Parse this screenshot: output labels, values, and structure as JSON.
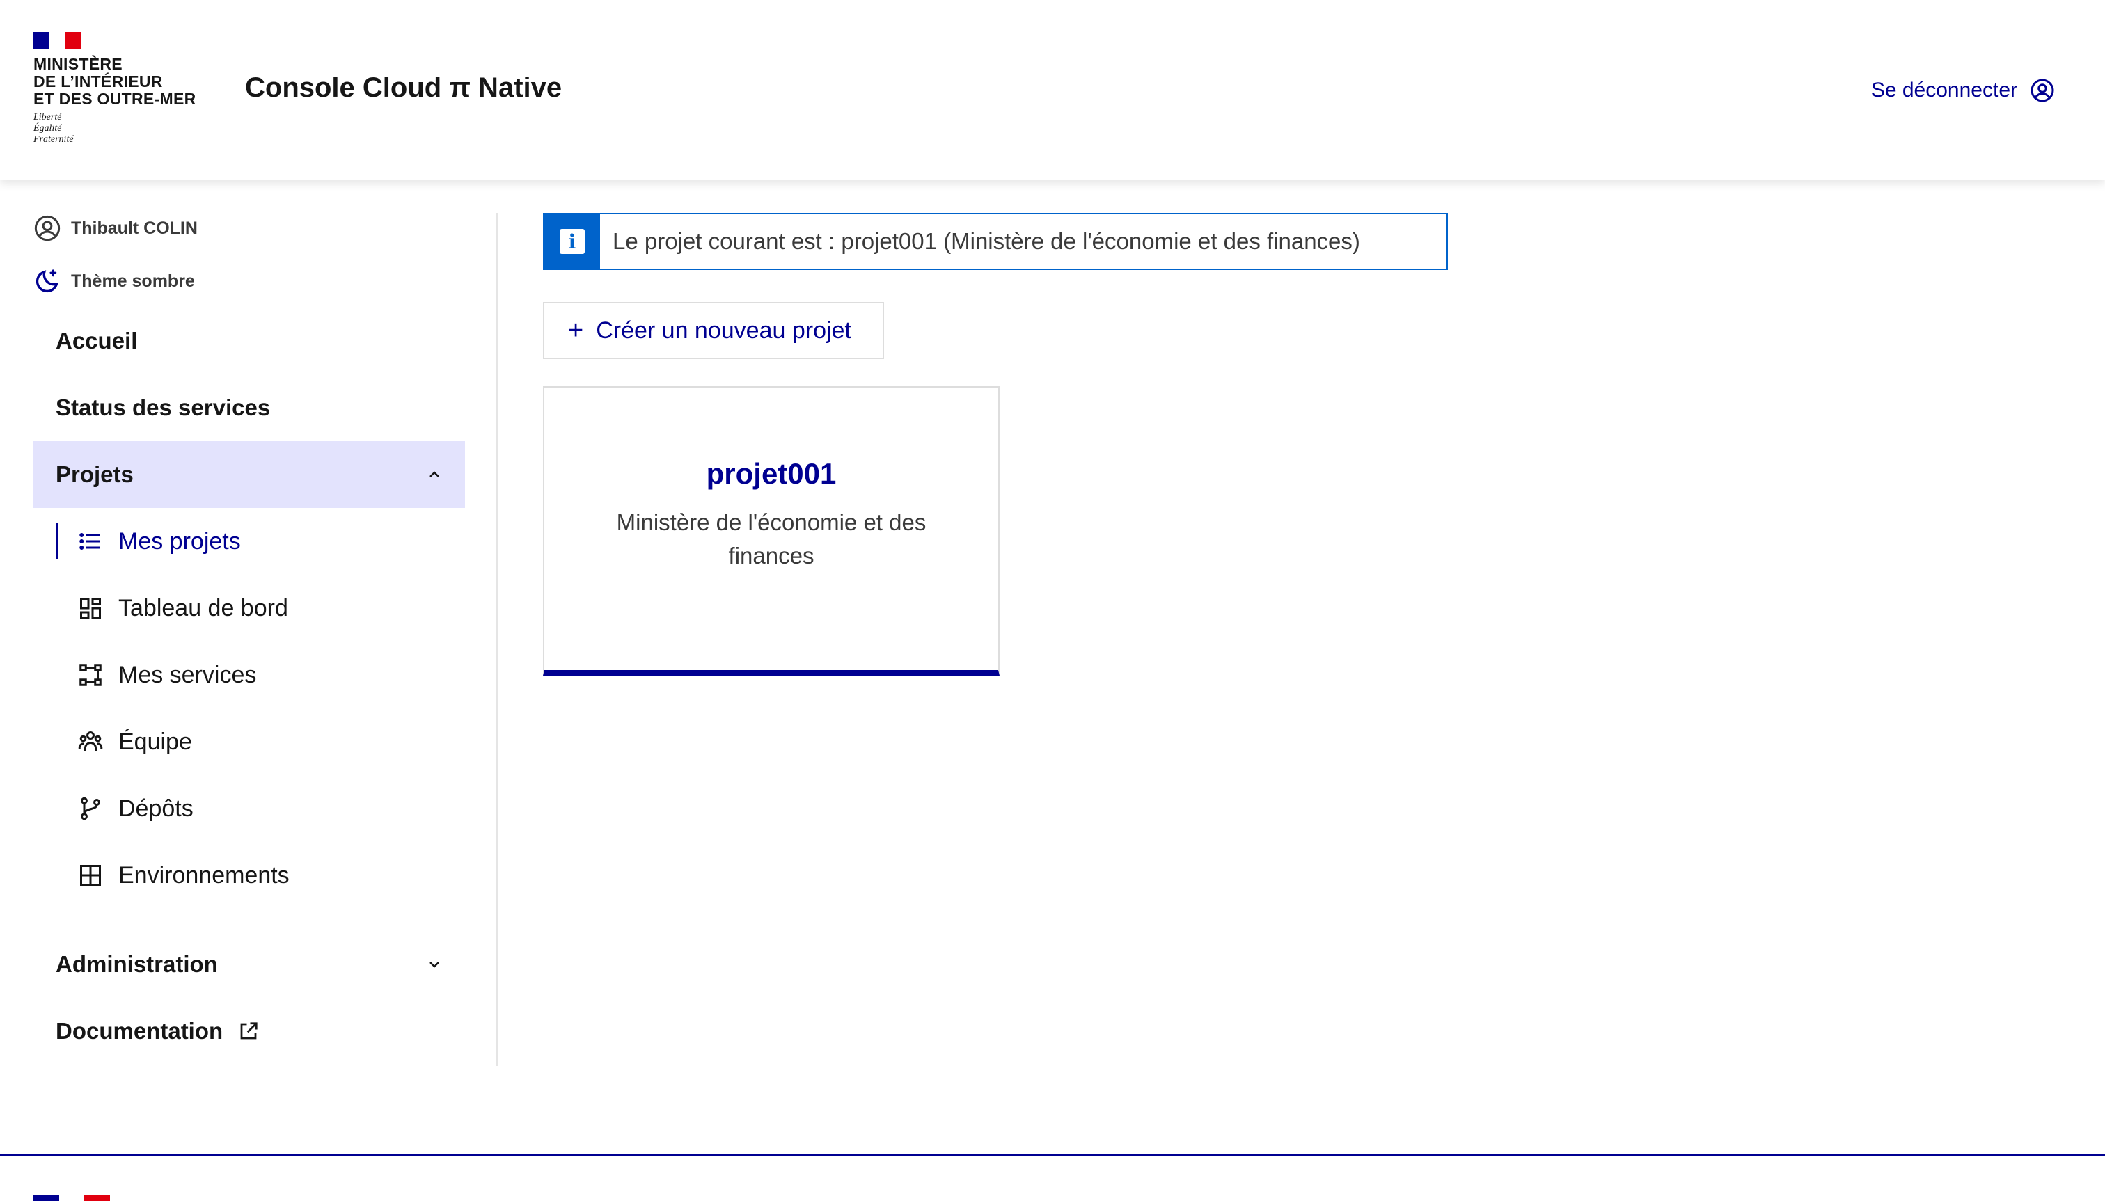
{
  "header": {
    "ministry": "MINISTÈRE\nDE L’INTÉRIEUR\nET DES OUTRE-MER",
    "devise": "Liberté\nÉgalité\nFraternité",
    "service_title": "Console Cloud π Native",
    "logout_label": "Se déconnecter"
  },
  "sidebar": {
    "user_name": "Thibault COLIN",
    "theme_label": "Thème sombre",
    "nav": {
      "home": "Accueil",
      "status": "Status des services",
      "projects": "Projets",
      "administration": "Administration",
      "documentation": "Documentation"
    },
    "project_items": [
      {
        "label": "Mes projets",
        "icon": "list-icon",
        "current": true
      },
      {
        "label": "Tableau de bord",
        "icon": "dashboard-icon",
        "current": false
      },
      {
        "label": "Mes services",
        "icon": "services-icon",
        "current": false
      },
      {
        "label": "Équipe",
        "icon": "team-icon",
        "current": false
      },
      {
        "label": "Dépôts",
        "icon": "git-branch-icon",
        "current": false
      },
      {
        "label": "Environnements",
        "icon": "grid-icon",
        "current": false
      }
    ]
  },
  "main": {
    "alert_text": "Le projet courant est : projet001 (Ministère de l'économie et des finances)",
    "create_project_label": "Créer un nouveau projet",
    "project_card": {
      "title": "projet001",
      "organization": "Ministère de l'économie et des finances"
    }
  },
  "colors": {
    "primary": "#000091",
    "active_background": "#e3e3fd",
    "info": "#0063cb",
    "marianne_red": "#e1000f"
  }
}
